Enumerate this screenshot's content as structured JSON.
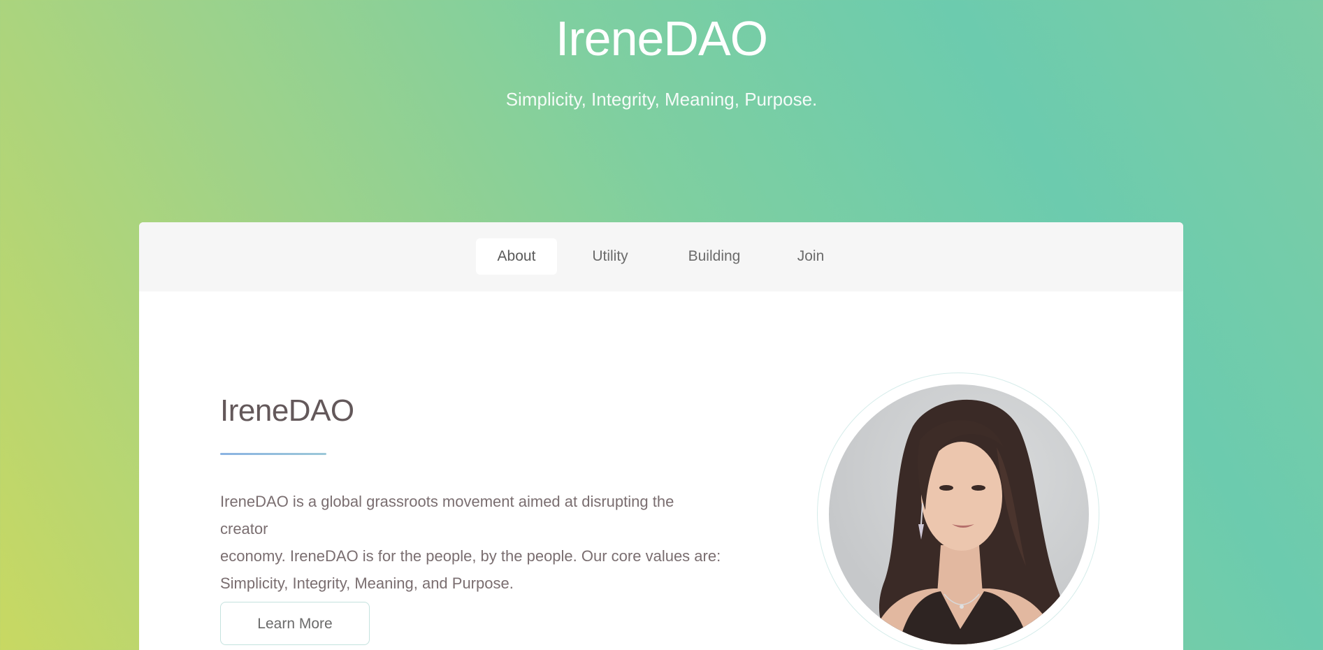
{
  "header": {
    "title": "IreneDAO",
    "tagline": "Simplicity, Integrity, Meaning, Purpose."
  },
  "tabs": [
    {
      "label": "About",
      "active": true
    },
    {
      "label": "Utility",
      "active": false
    },
    {
      "label": "Building",
      "active": false
    },
    {
      "label": "Join",
      "active": false
    }
  ],
  "about": {
    "heading": "IreneDAO",
    "body_lines": [
      "IreneDAO is a global grassroots movement aimed at disrupting the creator",
      "economy. IreneDAO is for the people, by the people. Our core values are:",
      "Simplicity, Integrity, Meaning, and Purpose."
    ],
    "button_label": "Learn More"
  },
  "colors": {
    "gradient_left": "#c8d862",
    "gradient_right": "#6ccbae",
    "divider": "#8ab3e2",
    "heading_text": "#63585a"
  }
}
